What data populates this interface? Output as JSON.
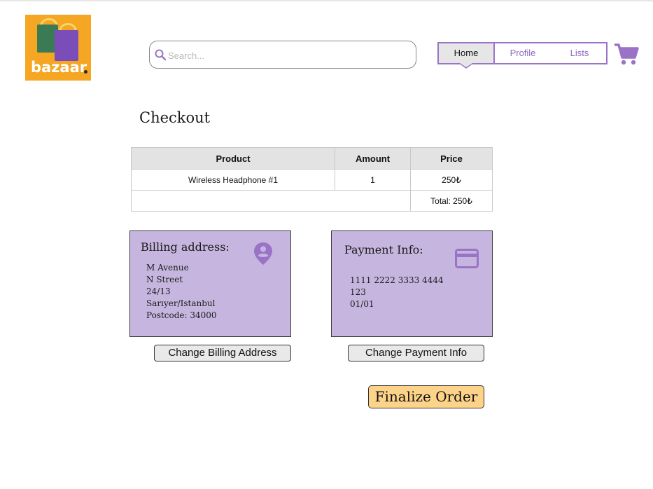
{
  "logo": {
    "text": "bazaar",
    "colors": {
      "background": "#f5a623",
      "bag_green": "#3a7a55",
      "bag_purple": "#7b4db8"
    }
  },
  "search": {
    "placeholder": "Search...",
    "value": "",
    "icon": "search-icon"
  },
  "nav": {
    "tabs": [
      {
        "label": "Home",
        "active": true
      },
      {
        "label": "Profile",
        "active": false
      },
      {
        "label": "Lists",
        "active": false
      }
    ],
    "cart_icon": "cart-icon"
  },
  "page": {
    "title": "Checkout"
  },
  "order_table": {
    "headers": [
      "Product",
      "Amount",
      "Price"
    ],
    "rows": [
      {
        "product": "Wireless Headphone #1",
        "amount": "1",
        "price": "250₺"
      }
    ],
    "total": "Total: 250₺"
  },
  "billing": {
    "title": "Billing address:",
    "icon": "location-pin-icon",
    "lines": [
      "M Avenue",
      "N Street",
      "24/13",
      "Sarıyer/Istanbul",
      "Postcode: 34000"
    ],
    "change_label": "Change Billing Address"
  },
  "payment": {
    "title": "Payment Info:",
    "icon": "credit-card-icon",
    "lines": [
      "1111 2222 3333 4444",
      "123",
      "01/01"
    ],
    "change_label": "Change Payment Info"
  },
  "finalize_label": "Finalize Order",
  "colors": {
    "accent": "#9a73c7",
    "card_bg": "#c6b6df",
    "finalize_bg": "#fdd38a"
  }
}
